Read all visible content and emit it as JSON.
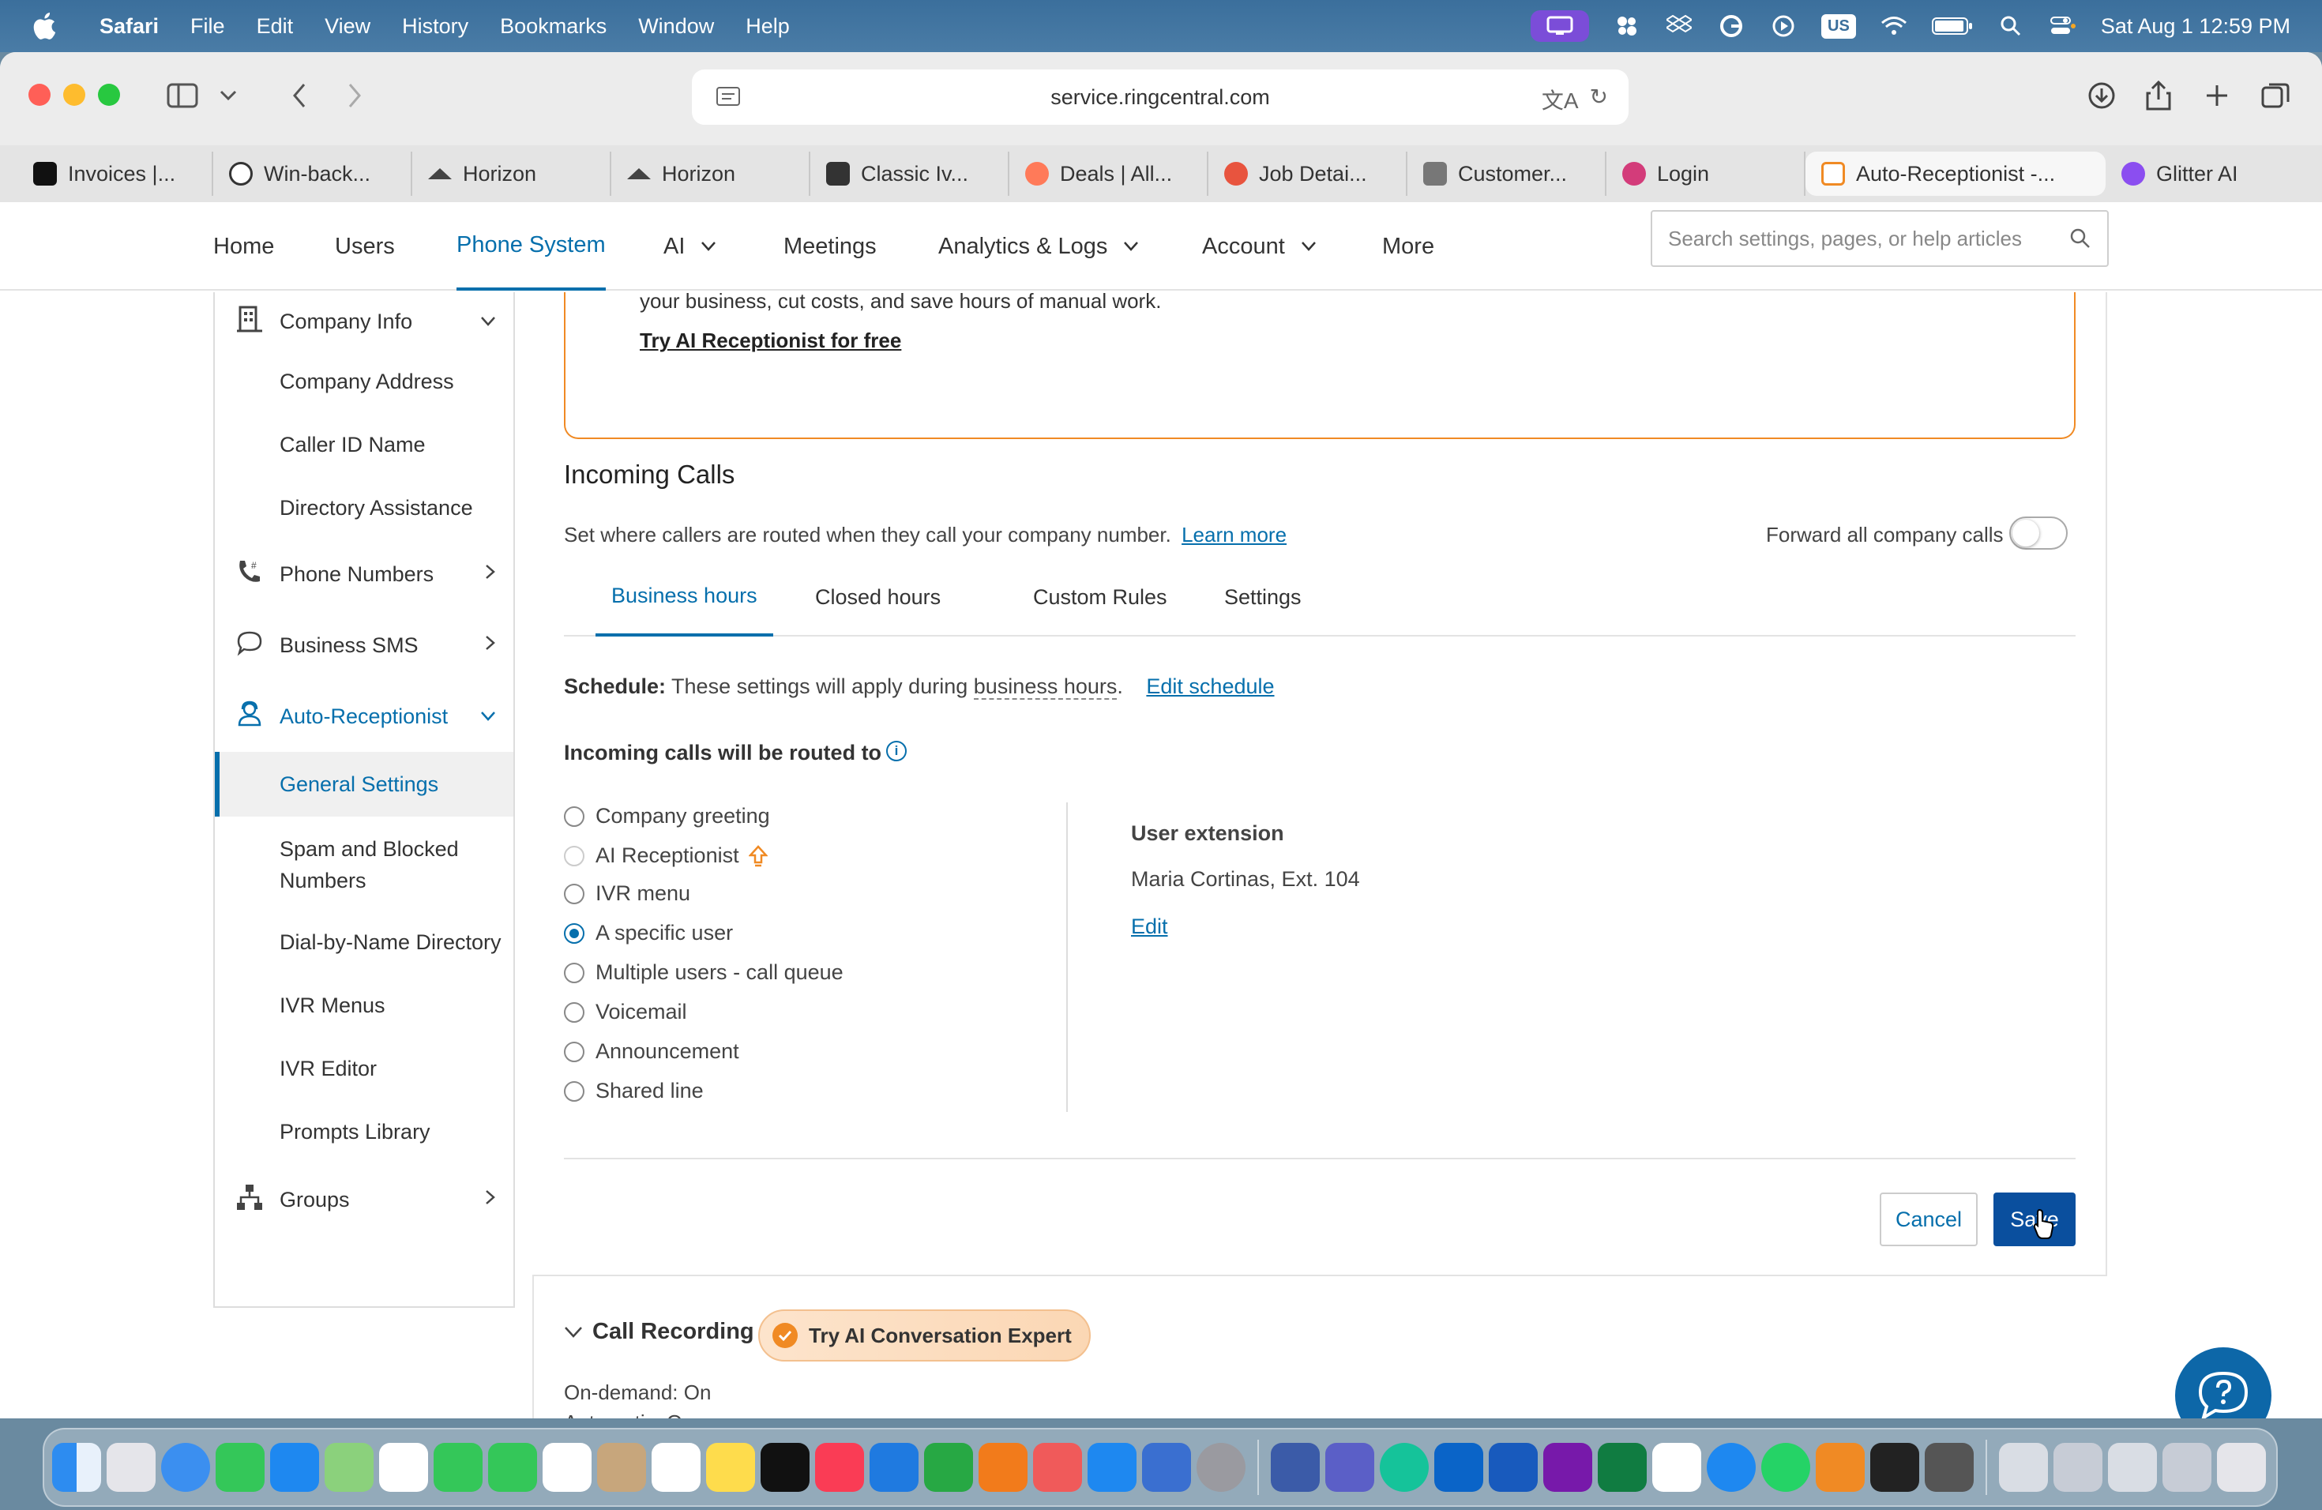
{
  "menubar": {
    "app": "Safari",
    "items": [
      "File",
      "Edit",
      "View",
      "History",
      "Bookmarks",
      "Window",
      "Help"
    ],
    "status_icons": [
      "screen-mirror-icon",
      "cluster-icon",
      "dropbox-icon",
      "grammarly-icon",
      "play-icon",
      "keyboard-layout-icon",
      "wifi-icon",
      "battery-icon",
      "spotlight-icon",
      "control-center-icon"
    ],
    "input_source": "US",
    "clock": "Sat Aug 1  12:59 PM"
  },
  "browser": {
    "url": "service.ringcentral.com",
    "tabs": [
      {
        "label": "Invoices |...",
        "color": "#111111"
      },
      {
        "label": "Win-back...",
        "color": "#333333"
      },
      {
        "label": "Horizon",
        "color": "#444444"
      },
      {
        "label": "Horizon",
        "color": "#444444"
      },
      {
        "label": "Classic Iv...",
        "color": "#333333"
      },
      {
        "label": "Deals | All...",
        "color": "#ff7a59"
      },
      {
        "label": "Job Detai...",
        "color": "#e8543e"
      },
      {
        "label": "Customer...",
        "color": "#777777"
      },
      {
        "label": "Login",
        "color": "#d33c7a"
      },
      {
        "label": "Auto-Receptionist -...",
        "color": "#f08a24"
      },
      {
        "label": "Glitter AI",
        "color": "#8b4ef0"
      }
    ],
    "active_tab": 9
  },
  "nav": {
    "items": [
      {
        "label": "Home",
        "dropdown": false
      },
      {
        "label": "Users",
        "dropdown": false
      },
      {
        "label": "Phone System",
        "dropdown": false
      },
      {
        "label": "AI",
        "dropdown": true
      },
      {
        "label": "Meetings",
        "dropdown": false
      },
      {
        "label": "Analytics & Logs",
        "dropdown": true
      },
      {
        "label": "Account",
        "dropdown": true
      },
      {
        "label": "More",
        "dropdown": false
      }
    ],
    "active": "Phone System",
    "search_placeholder": "Search settings, pages, or help articles"
  },
  "sidebar": {
    "company_info": "Company Info",
    "company_address": "Company Address",
    "caller_id": "Caller ID Name",
    "directory": "Directory Assistance",
    "phone_numbers": "Phone Numbers",
    "business_sms": "Business SMS",
    "auto_receptionist": "Auto-Receptionist",
    "general_settings": "General Settings",
    "spam_line1": "Spam and Blocked",
    "spam_line2": "Numbers",
    "dial_by_name": "Dial-by-Name Directory",
    "ivr_menus": "IVR Menus",
    "ivr_editor": "IVR Editor",
    "prompts": "Prompts Library",
    "groups": "Groups"
  },
  "promo": {
    "text": "your business, cut costs, and save hours of manual work.",
    "link": "Try AI Receptionist for free"
  },
  "incoming": {
    "title": "Incoming Calls",
    "description": "Set where callers are routed when they call your company number.",
    "learn_more": "Learn more",
    "forward_label": "Forward all company calls",
    "forward_on": false,
    "tabs": [
      "Business hours",
      "Closed hours",
      "Custom Rules",
      "Settings"
    ],
    "active_tab": "Business hours",
    "schedule_label": "Schedule:",
    "schedule_text": "These settings will apply during",
    "schedule_term": "business hours",
    "schedule_period": ".",
    "edit_schedule": "Edit schedule",
    "routed_label": "Incoming calls will be routed to",
    "options": [
      {
        "label": "Company greeting",
        "checked": false,
        "disabled": false
      },
      {
        "label": "AI Receptionist",
        "checked": false,
        "disabled": true
      },
      {
        "label": "IVR menu",
        "checked": false,
        "disabled": false
      },
      {
        "label": "A specific user",
        "checked": true,
        "disabled": false
      },
      {
        "label": "Multiple users - call queue",
        "checked": false,
        "disabled": false
      },
      {
        "label": "Voicemail",
        "checked": false,
        "disabled": false
      },
      {
        "label": "Announcement",
        "checked": false,
        "disabled": false
      },
      {
        "label": "Shared line",
        "checked": false,
        "disabled": false
      }
    ],
    "user_extension_label": "User extension",
    "user_extension_value": "Maria Cortinas, Ext. 104",
    "edit": "Edit",
    "cancel": "Cancel",
    "save": "Save"
  },
  "call_recording": {
    "title": "Call Recording",
    "ai_button": "Try AI Conversation Expert",
    "on_demand": "On-demand: On",
    "automatic": "Automatic: On"
  },
  "colors": {
    "accent": "#066fac",
    "save_button": "#0a4f9e",
    "promo_border": "#f08a24",
    "menubar": "#3b6f9c"
  }
}
